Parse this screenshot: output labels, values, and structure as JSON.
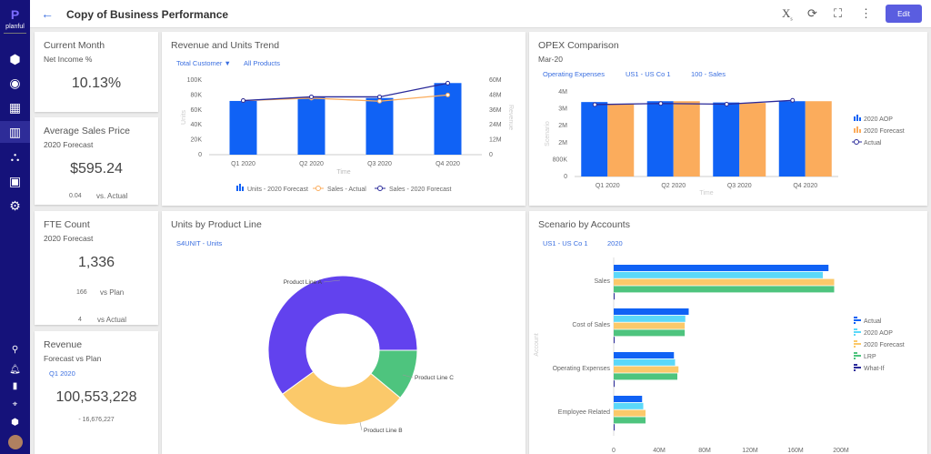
{
  "app": {
    "logo": "planful",
    "title": "Copy of Business Performance",
    "edit_label": "Edit"
  },
  "sidebar": {
    "items": [
      "cube",
      "target",
      "grid",
      "report",
      "hierarchy",
      "clipboard",
      "gear"
    ],
    "bottom": [
      "search",
      "bell",
      "bookmark",
      "crosshair",
      "cube",
      "avatar"
    ],
    "active": "report"
  },
  "kpis": [
    {
      "title": "Current Month",
      "subtitle": "Net Income %",
      "value": "10.13%"
    },
    {
      "title": "Average Sales Price",
      "subtitle": "2020 Forecast",
      "value": "$595.24",
      "delta": "0.04",
      "delta_label": "vs. Actual"
    },
    {
      "title": "FTE Count",
      "subtitle": "2020 Forecast",
      "value": "1,336",
      "delta": "166",
      "delta_label": "vs Plan",
      "delta2": "4",
      "delta2_label": "vs Actual"
    },
    {
      "title": "Revenue",
      "subtitle": "Forecast vs Plan",
      "filter": "Q1 2020",
      "value": "100,553,228",
      "delta": "- 16,676,227"
    }
  ],
  "colors": {
    "blue": "#1062f5",
    "orange": "#fbac5c",
    "navy": "#2a2a9a",
    "cyan": "#5bd8f9",
    "yellow": "#fbc96a",
    "green": "#4ec47e",
    "purple": "#6242ee",
    "sidebar": "#15127a",
    "accent": "#5a5de0"
  },
  "chart_data": [
    {
      "id": "rev",
      "type": "bar+line",
      "title": "Revenue and Units Trend",
      "filters": [
        "Total Customer",
        "All Products"
      ],
      "xlabel": "Time",
      "ylabel": "Units",
      "y2label": "Revenue",
      "categories": [
        "Q1 2020",
        "Q2 2020",
        "Q3 2020",
        "Q4 2020"
      ],
      "ylim": [
        0,
        100000
      ],
      "yticks": [
        "0",
        "20K",
        "40K",
        "60K",
        "80K",
        "100K"
      ],
      "y2lim": [
        0,
        60000000
      ],
      "y2ticks": [
        "0",
        "12M",
        "24M",
        "36M",
        "48M",
        "60M"
      ],
      "series": [
        {
          "name": "Units - 2020 Forecast",
          "type": "bar",
          "axis": "left",
          "values": [
            72000,
            77000,
            76000,
            96000
          ]
        },
        {
          "name": "Sales - Actual",
          "type": "line",
          "axis": "right",
          "values": [
            43500000,
            45500000,
            43000000,
            48000000
          ]
        },
        {
          "name": "Sales - 2020 Forecast",
          "type": "line",
          "axis": "right",
          "values": [
            43500000,
            46500000,
            46500000,
            57500000
          ]
        }
      ],
      "legend": "bottom"
    },
    {
      "id": "opex",
      "type": "bar+line",
      "title": "OPEX Comparison",
      "subtitle": "Mar-20",
      "filters": [
        "Operating Expenses",
        "US1 - US Co 1",
        "100 - Sales"
      ],
      "xlabel": "Time",
      "ylabel": "Scenario",
      "categories": [
        "Q1 2020",
        "Q2 2020",
        "Q3 2020",
        "Q4 2020"
      ],
      "ylim": [
        0,
        4000000
      ],
      "yticks": [
        "0",
        "800K",
        "2M",
        "2M",
        "3M",
        "4M"
      ],
      "series": [
        {
          "name": "2020 AOP",
          "type": "bar",
          "values": [
            3520000,
            3560000,
            3500000,
            3560000
          ]
        },
        {
          "name": "2020 Forecast",
          "type": "bar",
          "values": [
            3420000,
            3560000,
            3480000,
            3560000
          ]
        },
        {
          "name": "Actual",
          "type": "line",
          "values": [
            3400000,
            3450000,
            3420000,
            3600000
          ]
        }
      ],
      "legend": "right"
    },
    {
      "id": "units",
      "type": "pie",
      "title": "Units by Product Line",
      "filters": [
        "S4UNIT - Units"
      ],
      "labels": [
        "Product Line C",
        "Product Line B",
        "Product Line A"
      ],
      "values": [
        11,
        29,
        60
      ]
    },
    {
      "id": "scen",
      "type": "hbar",
      "title": "Scenario by Accounts",
      "filters": [
        "US1 - US Co 1",
        "2020"
      ],
      "ylabel": "Account",
      "categories": [
        "Sales",
        "Cost of Sales",
        "Operating Expenses",
        "Employee Related"
      ],
      "xlim": [
        0,
        200000000
      ],
      "xticks": [
        "0",
        "40M",
        "80M",
        "120M",
        "160M",
        "200M"
      ],
      "series": [
        {
          "name": "Actual",
          "values": [
            189000000,
            66000000,
            53000000,
            25000000
          ]
        },
        {
          "name": "2020 AOP",
          "values": [
            184000000,
            63000000,
            54000000,
            26000000
          ]
        },
        {
          "name": "2020 Forecast",
          "values": [
            194000000,
            62500000,
            57000000,
            28000000
          ]
        },
        {
          "name": "LRP",
          "values": [
            194000000,
            62500000,
            56000000,
            28000000
          ]
        },
        {
          "name": "What-If",
          "values": [
            0,
            0,
            0,
            0
          ]
        }
      ],
      "legend": "right"
    }
  ]
}
